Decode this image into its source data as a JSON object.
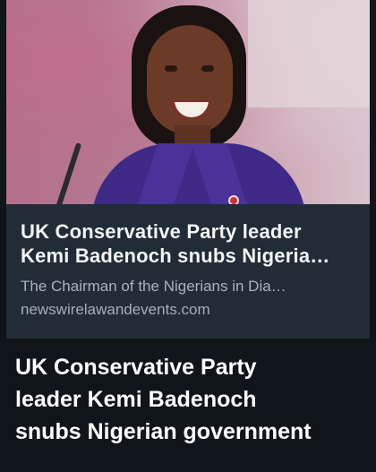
{
  "link_card": {
    "headline_line1": "UK Conservative Party leader",
    "headline_line2": "Kemi Badenoch snubs Nigeria…",
    "summary": "The Chairman of the Nigerians in Dia…",
    "source_domain": "newswirelawandevents.com"
  },
  "caption": {
    "line1": "UK Conservative Party",
    "line2": "leader Kemi Badenoch",
    "line3": "snubs Nigerian government"
  },
  "colors": {
    "background": "#101519",
    "card": "#212c36",
    "headline": "#f2f4f6",
    "muted_text": "#a9b2ba"
  }
}
